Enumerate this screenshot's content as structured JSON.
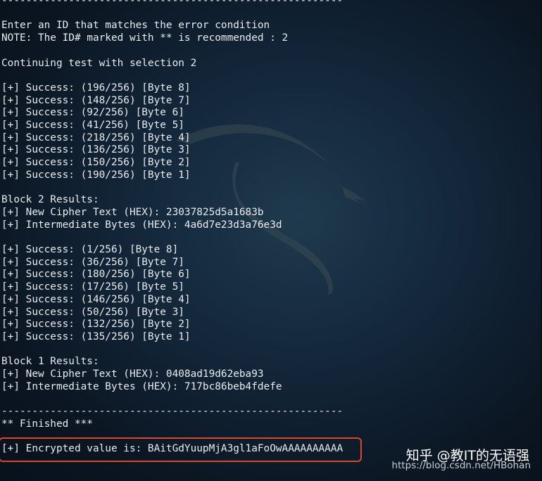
{
  "terminal": {
    "lines": [
      "--------------------------------------------------------",
      "",
      "Enter an ID that matches the error condition",
      "NOTE: The ID# marked with ** is recommended : 2",
      "",
      "Continuing test with selection 2",
      "",
      "[+] Success: (196/256) [Byte 8]",
      "[+] Success: (148/256) [Byte 7]",
      "[+] Success: (92/256) [Byte 6]",
      "[+] Success: (41/256) [Byte 5]",
      "[+] Success: (218/256) [Byte 4]",
      "[+] Success: (136/256) [Byte 3]",
      "[+] Success: (150/256) [Byte 2]",
      "[+] Success: (190/256) [Byte 1]",
      "",
      "Block 2 Results:",
      "[+] New Cipher Text (HEX): 23037825d5a1683b",
      "[+] Intermediate Bytes (HEX): 4a6d7e23d3a76e3d",
      "",
      "[+] Success: (1/256) [Byte 8]",
      "[+] Success: (36/256) [Byte 7]",
      "[+] Success: (180/256) [Byte 6]",
      "[+] Success: (17/256) [Byte 5]",
      "[+] Success: (146/256) [Byte 4]",
      "[+] Success: (50/256) [Byte 3]",
      "[+] Success: (132/256) [Byte 2]",
      "[+] Success: (135/256) [Byte 1]",
      "",
      "Block 1 Results:",
      "[+] New Cipher Text (HEX): 0408ad19d62eba93",
      "[+] Intermediate Bytes (HEX): 717bc86beb4fdefe",
      "",
      "--------------------------------------------------------",
      "** Finished ***",
      "",
      "[+] Encrypted value is: BAitGdYuupMjA3gl1aFoOwAAAAAAAAAA",
      "--------------------------------------------------------"
    ]
  },
  "watermark": {
    "brand": "知乎 @教IT的无语强",
    "url": "https://blog.csdn.net/HBohan"
  },
  "colors": {
    "text": "#e8ecef",
    "highlight_border": "#d94a2b",
    "background": "#13263a"
  }
}
